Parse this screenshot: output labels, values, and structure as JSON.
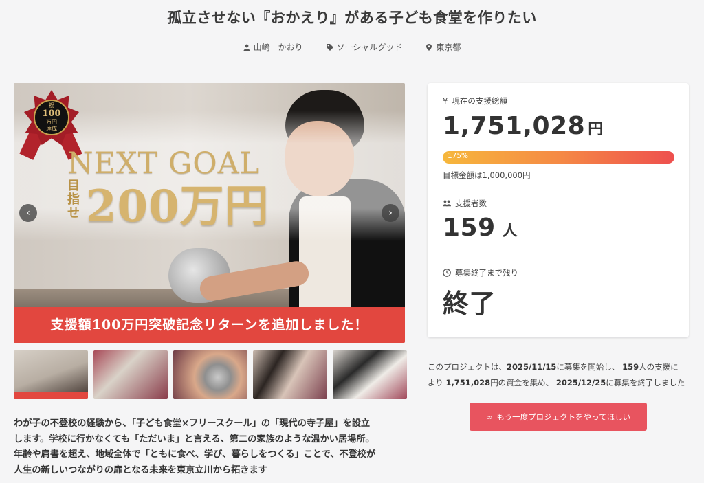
{
  "project": {
    "title": "孤立させない『おかえり』がある子ども食堂を作りたい",
    "owner": "山崎　かおり",
    "category": "ソーシャルグッド",
    "location": "東京都"
  },
  "hero": {
    "badge_top": "祝",
    "badge_amount": "100",
    "badge_unit": "万円",
    "badge_bottom": "達成",
    "next_goal": "NEXT GOAL",
    "mezase": "目指せ",
    "goal_amount": "200万円",
    "strip_text": "支援額100万円突破記念リターンを追加しました！",
    "prev_arrow": "‹",
    "next_arrow": "›"
  },
  "thumbnails": [
    "thumb-1",
    "thumb-2",
    "thumb-3",
    "thumb-4",
    "thumb-5"
  ],
  "description": {
    "lines": [
      "わが子の不登校の経験から、「子ども食堂×フリースクール」の「現代の寺子屋」を設立",
      "します。学校に行かなくても「ただいま」と言える、第二の家族のような温かい居場所。",
      "年齢や肩書を超え、地域全体で「ともに食べ、学び、暮らしをつくる」ことで、不登校が",
      "人生の新しいつながりの扉となる未来を東京立川から拓きます"
    ]
  },
  "stats": {
    "total_label": "現在の支援総額",
    "currency_symbol": "¥",
    "total_amount": "1,751,028",
    "total_unit": "円",
    "progress_label": "175%",
    "progress_fraction": 1.0,
    "goal_note": "目標金額は1,000,000円",
    "supporters_label": "支援者数",
    "supporters_count": "159",
    "supporters_unit": "人",
    "remaining_label": "募集終了まで残り",
    "remaining_value": "終了"
  },
  "summary": {
    "p1": "このプロジェクトは、",
    "start_date": "2025/11/15",
    "p2": "に募集を開始し、",
    "count": "159",
    "p3": "人の支援に",
    "p4": "より",
    "amount": "1,751,028",
    "p5": "円の資金を集め、",
    "end_date": "2025/12/25",
    "p6": "に募集を終了しました"
  },
  "actions": {
    "again_icon": "∞",
    "again_label": "もう一度プロジェクトをやってほしい"
  },
  "colors": {
    "accent_red": "#e2473f",
    "button_red": "#e8545f",
    "progress_start": "#f6b73c",
    "progress_end": "#ee4f4e"
  }
}
